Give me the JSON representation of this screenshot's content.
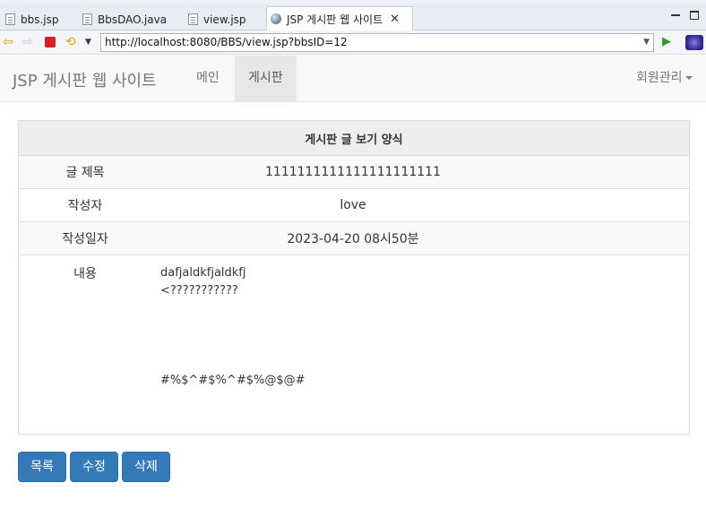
{
  "ide": {
    "tabs": [
      {
        "label": "bbs.jsp"
      },
      {
        "label": "BbsDAO.java"
      },
      {
        "label": "view.jsp"
      },
      {
        "label": "JSP 게시판 웹 사이트"
      }
    ],
    "close_glyph": "✕"
  },
  "browser": {
    "url": "http://localhost:8080/BBS/view.jsp?bbsID=12"
  },
  "site": {
    "brand": "JSP 게시판 웹 사이트",
    "menu_main": "메인",
    "menu_board": "게시판",
    "member_menu": "회원관리"
  },
  "view": {
    "header": "게시판 글 보기 양식",
    "title_label": "글 제목",
    "title_value": "1111111111111111111111",
    "author_label": "작성자",
    "author_value": "love",
    "date_label": "작성일자",
    "date_value": "2023-04-20 08시50분",
    "content_label": "내용",
    "content_value": "dafjaldkfjaldkfj\n<???????????\n\n\n\n\n#%$^#$%^#$%@$@#"
  },
  "buttons": {
    "list": "목록",
    "edit": "수정",
    "delete": "삭제"
  },
  "colors": {
    "primary_button": "#337ab7",
    "navbar_bg": "#f8f8f8",
    "active_menu_bg": "#e7e7e7"
  }
}
